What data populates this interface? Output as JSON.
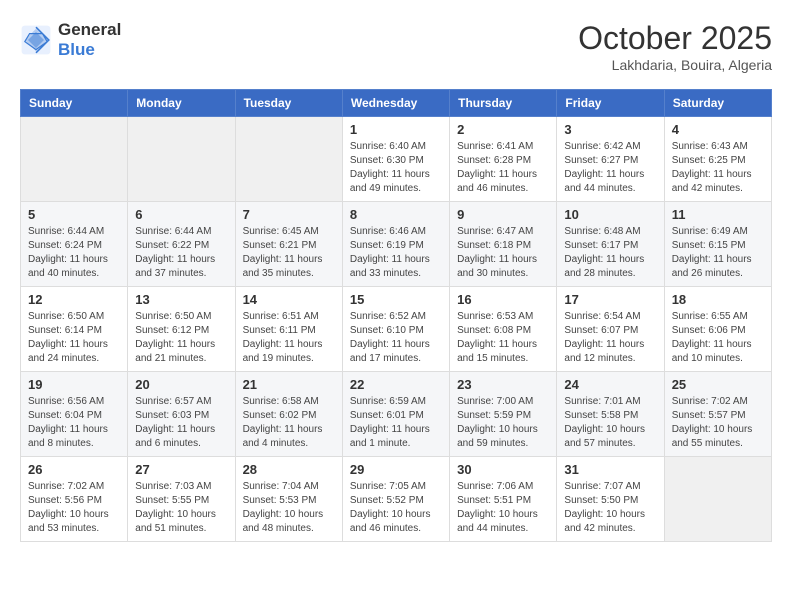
{
  "header": {
    "logo_line1": "General",
    "logo_line2": "Blue",
    "month": "October 2025",
    "location": "Lakhdaria, Bouira, Algeria"
  },
  "weekdays": [
    "Sunday",
    "Monday",
    "Tuesday",
    "Wednesday",
    "Thursday",
    "Friday",
    "Saturday"
  ],
  "weeks": [
    [
      {
        "day": "",
        "info": ""
      },
      {
        "day": "",
        "info": ""
      },
      {
        "day": "",
        "info": ""
      },
      {
        "day": "1",
        "info": "Sunrise: 6:40 AM\nSunset: 6:30 PM\nDaylight: 11 hours\nand 49 minutes."
      },
      {
        "day": "2",
        "info": "Sunrise: 6:41 AM\nSunset: 6:28 PM\nDaylight: 11 hours\nand 46 minutes."
      },
      {
        "day": "3",
        "info": "Sunrise: 6:42 AM\nSunset: 6:27 PM\nDaylight: 11 hours\nand 44 minutes."
      },
      {
        "day": "4",
        "info": "Sunrise: 6:43 AM\nSunset: 6:25 PM\nDaylight: 11 hours\nand 42 minutes."
      }
    ],
    [
      {
        "day": "5",
        "info": "Sunrise: 6:44 AM\nSunset: 6:24 PM\nDaylight: 11 hours\nand 40 minutes."
      },
      {
        "day": "6",
        "info": "Sunrise: 6:44 AM\nSunset: 6:22 PM\nDaylight: 11 hours\nand 37 minutes."
      },
      {
        "day": "7",
        "info": "Sunrise: 6:45 AM\nSunset: 6:21 PM\nDaylight: 11 hours\nand 35 minutes."
      },
      {
        "day": "8",
        "info": "Sunrise: 6:46 AM\nSunset: 6:19 PM\nDaylight: 11 hours\nand 33 minutes."
      },
      {
        "day": "9",
        "info": "Sunrise: 6:47 AM\nSunset: 6:18 PM\nDaylight: 11 hours\nand 30 minutes."
      },
      {
        "day": "10",
        "info": "Sunrise: 6:48 AM\nSunset: 6:17 PM\nDaylight: 11 hours\nand 28 minutes."
      },
      {
        "day": "11",
        "info": "Sunrise: 6:49 AM\nSunset: 6:15 PM\nDaylight: 11 hours\nand 26 minutes."
      }
    ],
    [
      {
        "day": "12",
        "info": "Sunrise: 6:50 AM\nSunset: 6:14 PM\nDaylight: 11 hours\nand 24 minutes."
      },
      {
        "day": "13",
        "info": "Sunrise: 6:50 AM\nSunset: 6:12 PM\nDaylight: 11 hours\nand 21 minutes."
      },
      {
        "day": "14",
        "info": "Sunrise: 6:51 AM\nSunset: 6:11 PM\nDaylight: 11 hours\nand 19 minutes."
      },
      {
        "day": "15",
        "info": "Sunrise: 6:52 AM\nSunset: 6:10 PM\nDaylight: 11 hours\nand 17 minutes."
      },
      {
        "day": "16",
        "info": "Sunrise: 6:53 AM\nSunset: 6:08 PM\nDaylight: 11 hours\nand 15 minutes."
      },
      {
        "day": "17",
        "info": "Sunrise: 6:54 AM\nSunset: 6:07 PM\nDaylight: 11 hours\nand 12 minutes."
      },
      {
        "day": "18",
        "info": "Sunrise: 6:55 AM\nSunset: 6:06 PM\nDaylight: 11 hours\nand 10 minutes."
      }
    ],
    [
      {
        "day": "19",
        "info": "Sunrise: 6:56 AM\nSunset: 6:04 PM\nDaylight: 11 hours\nand 8 minutes."
      },
      {
        "day": "20",
        "info": "Sunrise: 6:57 AM\nSunset: 6:03 PM\nDaylight: 11 hours\nand 6 minutes."
      },
      {
        "day": "21",
        "info": "Sunrise: 6:58 AM\nSunset: 6:02 PM\nDaylight: 11 hours\nand 4 minutes."
      },
      {
        "day": "22",
        "info": "Sunrise: 6:59 AM\nSunset: 6:01 PM\nDaylight: 11 hours\nand 1 minute."
      },
      {
        "day": "23",
        "info": "Sunrise: 7:00 AM\nSunset: 5:59 PM\nDaylight: 10 hours\nand 59 minutes."
      },
      {
        "day": "24",
        "info": "Sunrise: 7:01 AM\nSunset: 5:58 PM\nDaylight: 10 hours\nand 57 minutes."
      },
      {
        "day": "25",
        "info": "Sunrise: 7:02 AM\nSunset: 5:57 PM\nDaylight: 10 hours\nand 55 minutes."
      }
    ],
    [
      {
        "day": "26",
        "info": "Sunrise: 7:02 AM\nSunset: 5:56 PM\nDaylight: 10 hours\nand 53 minutes."
      },
      {
        "day": "27",
        "info": "Sunrise: 7:03 AM\nSunset: 5:55 PM\nDaylight: 10 hours\nand 51 minutes."
      },
      {
        "day": "28",
        "info": "Sunrise: 7:04 AM\nSunset: 5:53 PM\nDaylight: 10 hours\nand 48 minutes."
      },
      {
        "day": "29",
        "info": "Sunrise: 7:05 AM\nSunset: 5:52 PM\nDaylight: 10 hours\nand 46 minutes."
      },
      {
        "day": "30",
        "info": "Sunrise: 7:06 AM\nSunset: 5:51 PM\nDaylight: 10 hours\nand 44 minutes."
      },
      {
        "day": "31",
        "info": "Sunrise: 7:07 AM\nSunset: 5:50 PM\nDaylight: 10 hours\nand 42 minutes."
      },
      {
        "day": "",
        "info": ""
      }
    ]
  ]
}
